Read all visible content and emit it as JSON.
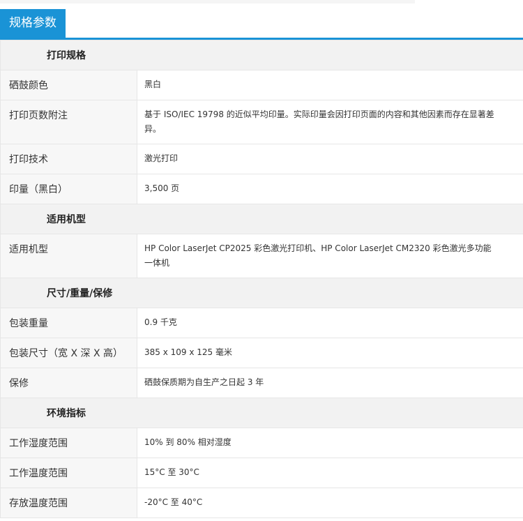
{
  "header": {
    "title": "规格参数"
  },
  "sections": [
    {
      "title": "打印规格",
      "rows": [
        {
          "label": "硒鼓颜色",
          "value": "黑白"
        },
        {
          "label": "打印页数附注",
          "value": "基于 ISO/IEC 19798 的近似平均印量。实际印量会因打印页面的内容和其他因素而存在显著差异。"
        },
        {
          "label": "打印技术",
          "value": "激光打印"
        },
        {
          "label": "印量（黑白）",
          "value": "3,500 页"
        }
      ]
    },
    {
      "title": "适用机型",
      "rows": [
        {
          "label": "适用机型",
          "value": "HP Color LaserJet CP2025 彩色激光打印机、HP Color LaserJet CM2320 彩色激光多功能一体机"
        }
      ]
    },
    {
      "title": "尺寸/重量/保修",
      "rows": [
        {
          "label": "包装重量",
          "value": "0.9 千克"
        },
        {
          "label": "包装尺寸（宽 X 深 X 高）",
          "value": "385 x 109 x 125 毫米"
        },
        {
          "label": "保修",
          "value": "硒鼓保质期为自生产之日起 3 年"
        }
      ]
    },
    {
      "title": "环境指标",
      "rows": [
        {
          "label": "工作湿度范围",
          "value": "10% 到 80% 相对湿度"
        },
        {
          "label": "工作温度范围",
          "value": "15°C 至 30°C"
        },
        {
          "label": "存放温度范围",
          "value": "-20°C 至 40°C"
        }
      ]
    }
  ],
  "colors": {
    "accent": "#1a93d6",
    "section_bg": "#f2f2f2",
    "label_bg": "#f7f7f7",
    "border": "#e6e6e6"
  }
}
